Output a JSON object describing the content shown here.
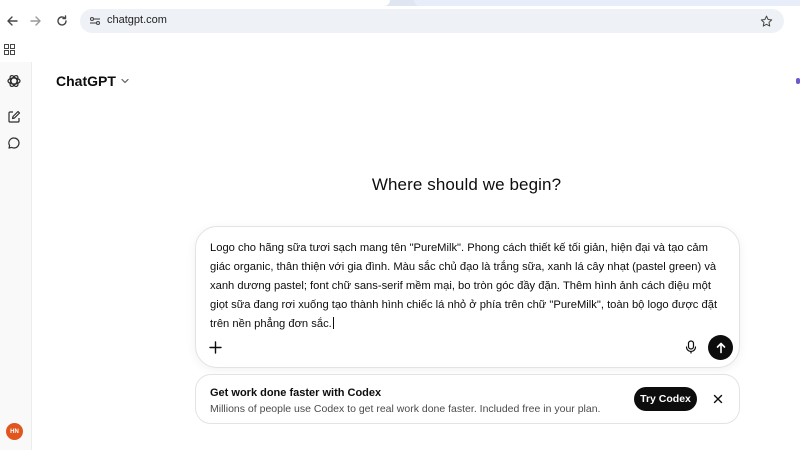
{
  "browser": {
    "url": "chatgpt.com"
  },
  "app": {
    "model_name": "ChatGPT",
    "avatar_initials": "HN",
    "accent_color": "#e0561f"
  },
  "main": {
    "heading": "Where should we begin?"
  },
  "composer": {
    "text": "Logo cho hãng sữa tươi sạch mang tên \"PureMilk\". Phong cách thiết kế tối giản, hiện đại và tạo cảm giác organic, thân thiện với gia đình. Màu sắc chủ đạo là trắng sữa, xanh lá cây nhạt (pastel green) và xanh dương pastel; font chữ sans-serif mềm mại, bo tròn góc đầy đặn. Thêm hình ảnh cách điệu một giọt sữa đang rơi xuống tạo thành hình chiếc lá nhỏ ở phía trên chữ \"PureMilk\", toàn bộ logo được đặt trên nền phẳng đơn sắc."
  },
  "codex_banner": {
    "title": "Get work done faster with Codex",
    "subtitle": "Millions of people use Codex to get real work done faster. Included free in your plan.",
    "button_label": "Try Codex"
  },
  "icons": [
    "back-arrow-icon",
    "forward-arrow-icon",
    "reload-icon",
    "site-info-icon",
    "star-icon",
    "apps-grid-icon",
    "openai-logo-icon",
    "new-chat-icon",
    "chat-bubble-icon",
    "chevron-down-icon",
    "plus-icon",
    "mic-icon",
    "send-arrow-icon",
    "close-icon"
  ]
}
